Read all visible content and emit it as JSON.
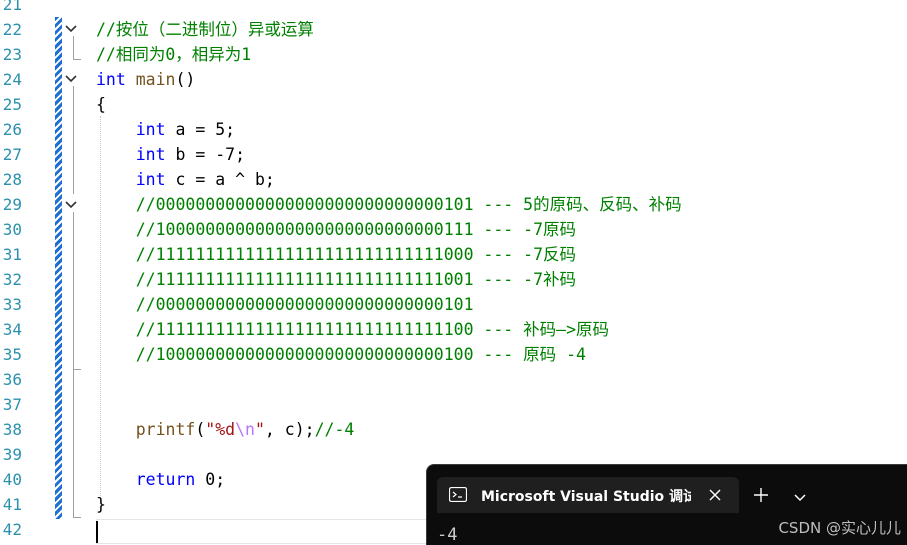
{
  "editor": {
    "lines": [
      {
        "num": "21",
        "tokens": []
      },
      {
        "num": "22",
        "tokens": [
          {
            "t": "//按位（二进制位）异或运算",
            "c": "cmt"
          }
        ]
      },
      {
        "num": "23",
        "tokens": [
          {
            "t": "//相同为0，相异为1",
            "c": "cmt"
          }
        ]
      },
      {
        "num": "24",
        "tokens": [
          {
            "t": "int",
            "c": "kw"
          },
          {
            "t": " ",
            "c": "plain"
          },
          {
            "t": "main",
            "c": "fn"
          },
          {
            "t": "()",
            "c": "plain"
          }
        ]
      },
      {
        "num": "25",
        "tokens": [
          {
            "t": "{",
            "c": "plain"
          }
        ]
      },
      {
        "num": "26",
        "tokens": [
          {
            "t": "    ",
            "c": "plain"
          },
          {
            "t": "int",
            "c": "kw"
          },
          {
            "t": " a = 5;",
            "c": "plain"
          }
        ]
      },
      {
        "num": "27",
        "tokens": [
          {
            "t": "    ",
            "c": "plain"
          },
          {
            "t": "int",
            "c": "kw"
          },
          {
            "t": " b = -7;",
            "c": "plain"
          }
        ]
      },
      {
        "num": "28",
        "tokens": [
          {
            "t": "    ",
            "c": "plain"
          },
          {
            "t": "int",
            "c": "kw"
          },
          {
            "t": " c = a ^ b;",
            "c": "plain"
          }
        ]
      },
      {
        "num": "29",
        "tokens": [
          {
            "t": "    ",
            "c": "plain"
          },
          {
            "t": "//00000000000000000000000000000101 --- 5的原码、反码、补码",
            "c": "cmt"
          }
        ]
      },
      {
        "num": "30",
        "tokens": [
          {
            "t": "    ",
            "c": "plain"
          },
          {
            "t": "//10000000000000000000000000000111 --- -7原码",
            "c": "cmt"
          }
        ]
      },
      {
        "num": "31",
        "tokens": [
          {
            "t": "    ",
            "c": "plain"
          },
          {
            "t": "//11111111111111111111111111111000 --- -7反码",
            "c": "cmt"
          }
        ]
      },
      {
        "num": "32",
        "tokens": [
          {
            "t": "    ",
            "c": "plain"
          },
          {
            "t": "//11111111111111111111111111111001 --- -7补码",
            "c": "cmt"
          }
        ]
      },
      {
        "num": "33",
        "tokens": [
          {
            "t": "    ",
            "c": "plain"
          },
          {
            "t": "//00000000000000000000000000000101",
            "c": "cmt"
          }
        ]
      },
      {
        "num": "34",
        "tokens": [
          {
            "t": "    ",
            "c": "plain"
          },
          {
            "t": "//11111111111111111111111111111100 --- 补码—>原码",
            "c": "cmt"
          }
        ]
      },
      {
        "num": "35",
        "tokens": [
          {
            "t": "    ",
            "c": "plain"
          },
          {
            "t": "//10000000000000000000000000000100 --- 原码 -4",
            "c": "cmt"
          }
        ]
      },
      {
        "num": "36",
        "tokens": []
      },
      {
        "num": "37",
        "tokens": []
      },
      {
        "num": "38",
        "tokens": [
          {
            "t": "    ",
            "c": "plain"
          },
          {
            "t": "printf",
            "c": "fn"
          },
          {
            "t": "(",
            "c": "plain"
          },
          {
            "t": "\"%d",
            "c": "str"
          },
          {
            "t": "\\n",
            "c": "esc"
          },
          {
            "t": "\"",
            "c": "str"
          },
          {
            "t": ", c);",
            "c": "plain"
          },
          {
            "t": "//-4",
            "c": "cmt"
          }
        ]
      },
      {
        "num": "39",
        "tokens": []
      },
      {
        "num": "40",
        "tokens": [
          {
            "t": "    ",
            "c": "plain"
          },
          {
            "t": "return",
            "c": "kw"
          },
          {
            "t": " 0;",
            "c": "plain"
          }
        ]
      },
      {
        "num": "41",
        "tokens": [
          {
            "t": "}",
            "c": "plain"
          }
        ]
      },
      {
        "num": "42",
        "tokens": []
      }
    ]
  },
  "terminal": {
    "tab_title": "Microsoft Visual Studio 调试控制台",
    "tab_icon": "console-icon",
    "output": "-4"
  },
  "watermark": "CSDN @实心儿儿",
  "colors": {
    "comment": "#008000",
    "keyword": "#0000ff",
    "line_number": "#2b91af",
    "change_bar": "#1f6fd1",
    "terminal_bg": "#0c0c0c"
  }
}
